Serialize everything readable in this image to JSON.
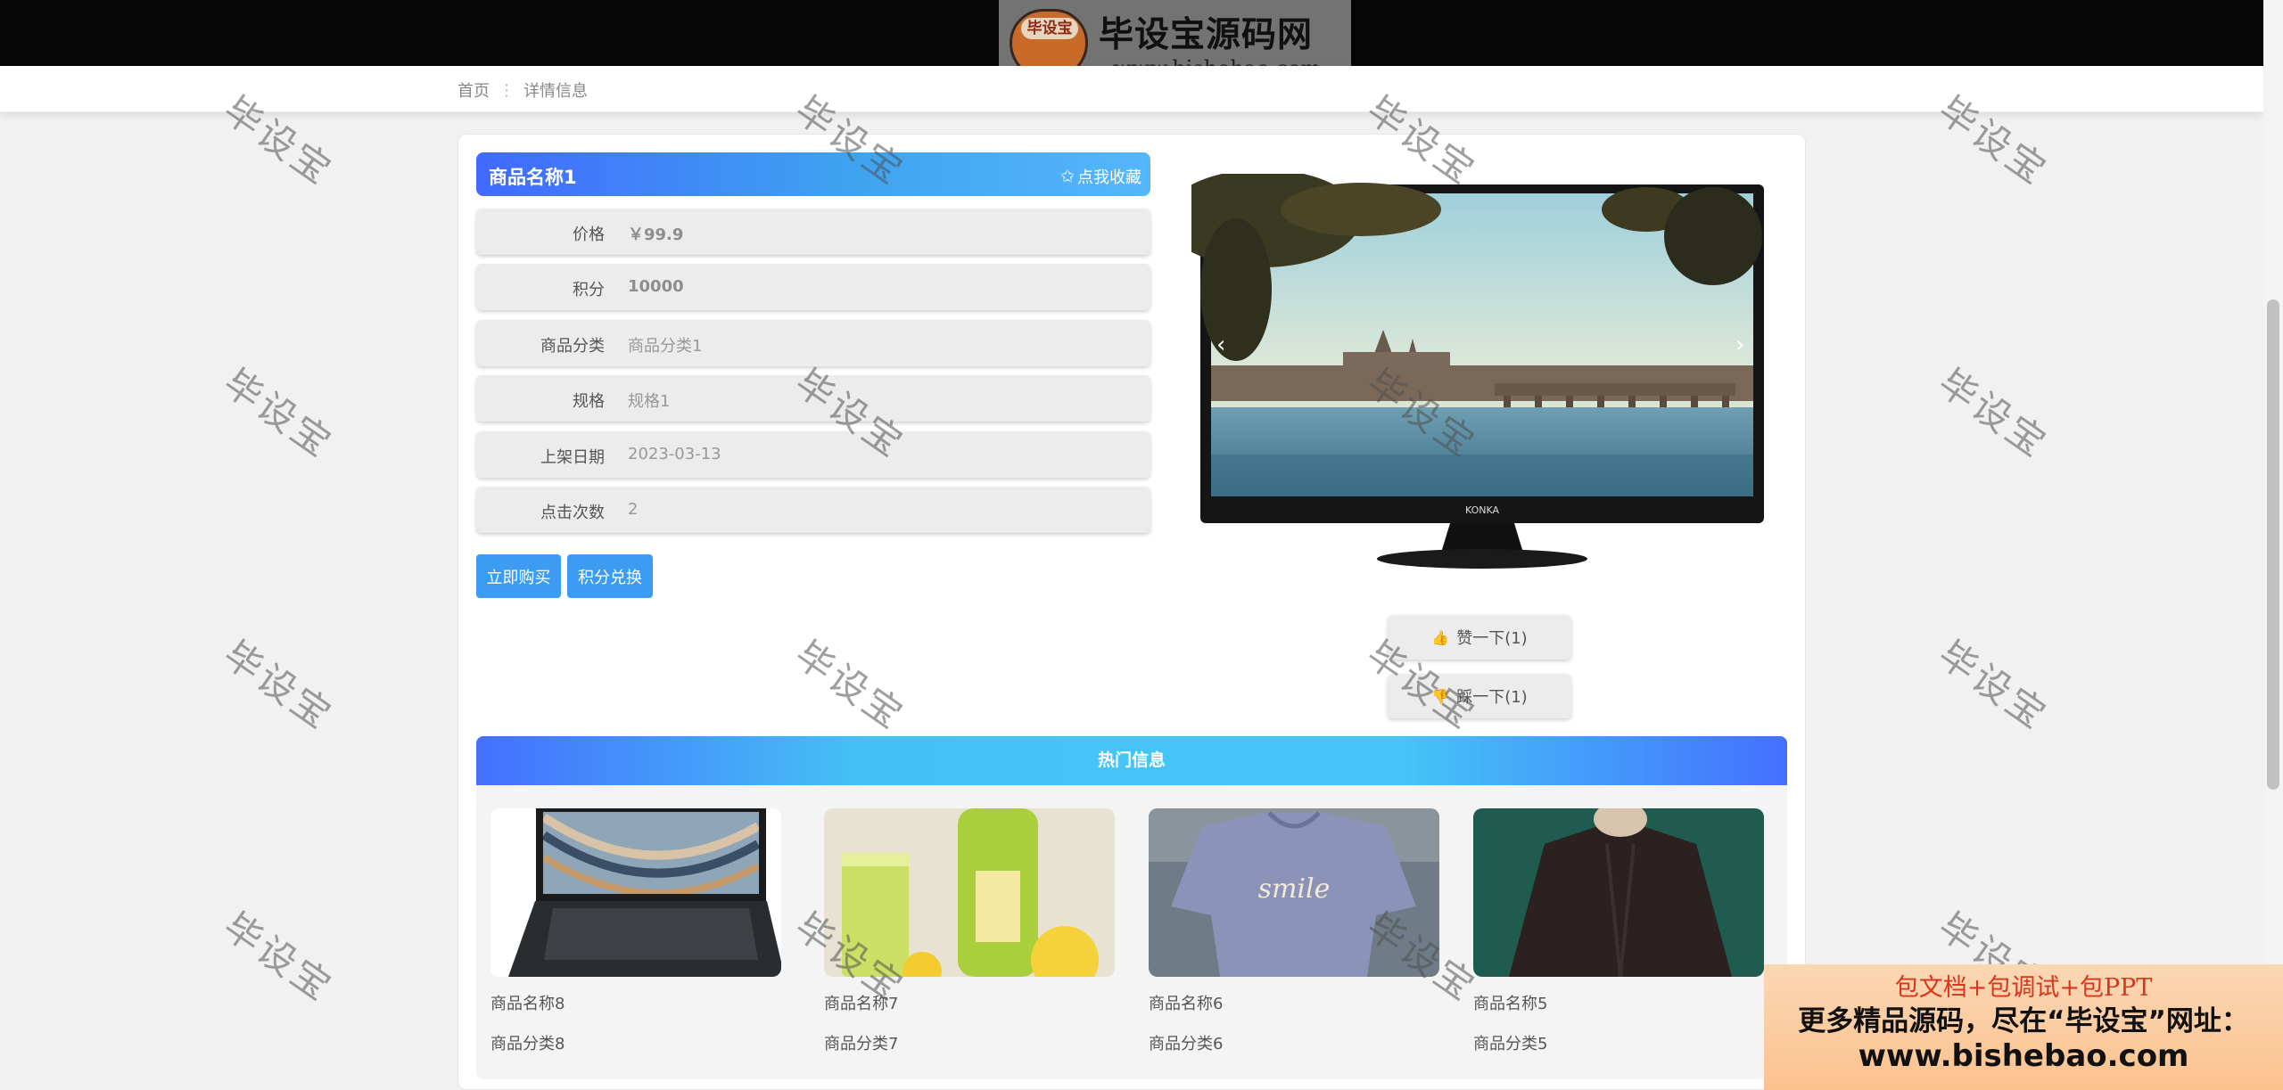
{
  "brand": {
    "badge_text": "毕设宝",
    "title": "毕设宝源码网",
    "url": "www.bishebao.com"
  },
  "breadcrumb": {
    "home": "首页",
    "separator": "⋮",
    "current": "详情信息"
  },
  "product": {
    "name": "商品名称1",
    "favorite_icon": "✩",
    "favorite_label": "点我收藏",
    "fields": [
      {
        "label": "价格",
        "value": "￥99.9"
      },
      {
        "label": "积分",
        "value": "10000"
      },
      {
        "label": "商品分类",
        "value": "商品分类1"
      },
      {
        "label": "规格",
        "value": "规格1"
      },
      {
        "label": "上架日期",
        "value": "2023-03-13"
      },
      {
        "label": "点击次数",
        "value": "2"
      }
    ],
    "buy_label": "立即购买",
    "redeem_label": "积分兑换",
    "image_icon": "konka-monitor-image",
    "monitor_brand": "KONKA",
    "carousel_prev": "‹",
    "carousel_next": "›",
    "like_label": "赞一下(1)",
    "dislike_label": "踩一下(1)"
  },
  "hot": {
    "title": "热门信息",
    "items": [
      {
        "name": "商品名称8",
        "category": "商品分类8",
        "image_icon": "laptop-image"
      },
      {
        "name": "商品名称7",
        "category": "商品分类7",
        "image_icon": "juice-image"
      },
      {
        "name": "商品名称6",
        "category": "商品分类6",
        "image_icon": "tshirt-image",
        "print": "smile"
      },
      {
        "name": "商品名称5",
        "category": "商品分类5",
        "image_icon": "jacket-image"
      }
    ]
  },
  "watermark_text": "毕设宝",
  "ad": {
    "line1": "包文档+包调试+包PPT",
    "line2": "更多精品源码，尽在“毕设宝”网址：",
    "line3": "www.bishebao.com"
  },
  "colors": {
    "accent": "#3c9cf4",
    "header_gradient_start": "#4169ff",
    "header_gradient_end": "#55b7fb",
    "hot_gradient_mid": "#45c2f4",
    "ad_red": "#d8351d"
  }
}
